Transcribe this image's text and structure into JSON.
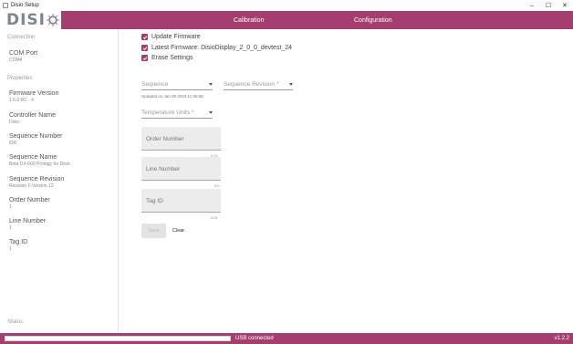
{
  "window": {
    "title": "Disio Setup",
    "minimize": "–",
    "maximize": "☐",
    "close": "✕"
  },
  "header": {
    "logo": "DISI",
    "tabs": [
      "Calibration",
      "Configuration"
    ]
  },
  "sidebar": {
    "connection_label": "Connection",
    "com_port": {
      "label": "COM Port",
      "value": "COM4"
    },
    "properties_label": "Properties",
    "properties": [
      {
        "label": "Firmware Version",
        "value": "1.6.0 RC - 4"
      },
      {
        "label": "Controller Name",
        "value": "Disio"
      },
      {
        "label": "Sequence Number",
        "value": "600"
      },
      {
        "label": "Sequence Name",
        "value": "Beta DX-600 Prodigy for Disio"
      },
      {
        "label": "Sequence Revision",
        "value": "Revision F Version 13"
      },
      {
        "label": "Order Number",
        "value": "1"
      },
      {
        "label": "Line Number",
        "value": "1"
      },
      {
        "label": "Tag ID",
        "value": "1"
      }
    ],
    "status_label": "Status"
  },
  "main": {
    "checkboxes": [
      {
        "label": "Update Firmware",
        "checked": true
      },
      {
        "label": "Latest Firmware: DisioDisplay_2_0_0_devtest_24",
        "checked": true
      },
      {
        "label": "Erase Settings",
        "checked": true
      }
    ],
    "sequence_select": {
      "label": "Sequence"
    },
    "sequence_revision_select": {
      "label": "Sequence Revision *"
    },
    "updated_note": "Updated on Jan 09 2023 11:06:58",
    "temperature_select": {
      "label": "Temperature Units *"
    },
    "order_number": {
      "label": "Order Number",
      "counter": "0/10"
    },
    "line_number": {
      "label": "Line Number",
      "counter": "0/5"
    },
    "tag_id": {
      "label": "Tag ID",
      "counter": "0/16"
    },
    "save_label": "Save",
    "clear_label": "Clear"
  },
  "status": {
    "progress": 0,
    "connection_text": "USB connected",
    "version": "v1.2.2"
  },
  "colors": {
    "accent": "#a63d6f"
  },
  "icons": {
    "window": "app-window-icon",
    "check": "check-icon",
    "caret": "caret-down-icon",
    "logo_dial": "dial-o-icon"
  }
}
